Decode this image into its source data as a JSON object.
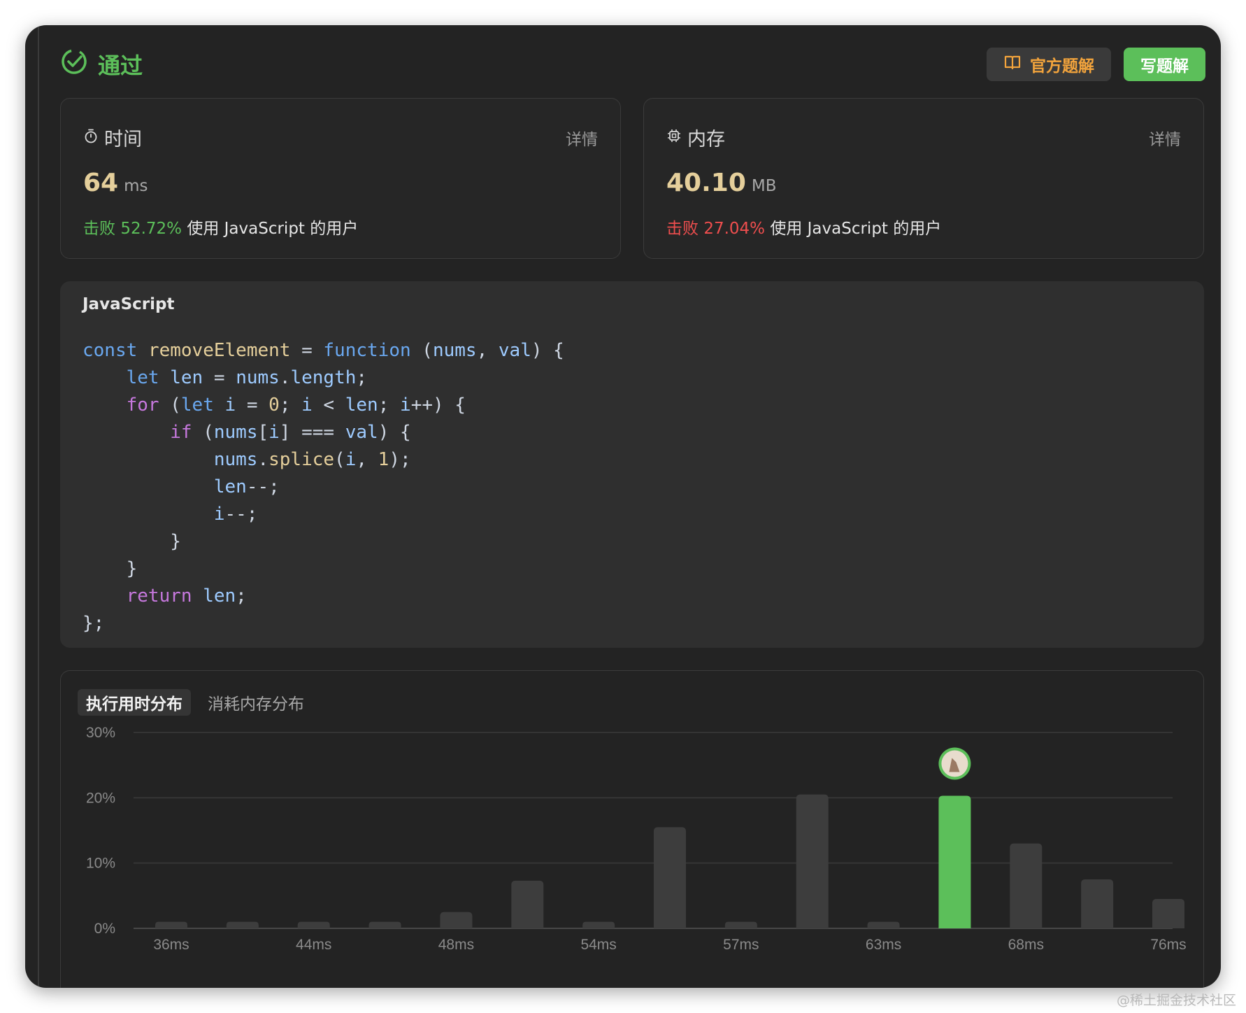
{
  "header": {
    "status": "通过",
    "official_solution_label": "官方题解",
    "write_solution_label": "写题解"
  },
  "colors": {
    "pass": "#5cbf5a",
    "fail": "#ef4e4e",
    "accent_orange": "#f3a43c"
  },
  "time_card": {
    "title": "时间",
    "detail": "详情",
    "value": "64",
    "unit": "ms",
    "beat_prefix": "击败",
    "beat_percent": "52.72%",
    "beat_suffix": "使用 JavaScript 的用户"
  },
  "memory_card": {
    "title": "内存",
    "detail": "详情",
    "value": "40.10",
    "unit": "MB",
    "beat_prefix": "击败",
    "beat_percent": "27.04%",
    "beat_suffix": "使用 JavaScript 的用户"
  },
  "code": {
    "language": "JavaScript",
    "lines": [
      "const removeElement = function (nums, val) {",
      "    let len = nums.length;",
      "    for (let i = 0; i < len; i++) {",
      "        if (nums[i] === val) {",
      "            nums.splice(i, 1);",
      "            len--;",
      "            i--;",
      "        }",
      "    }",
      "    return len;",
      "};"
    ]
  },
  "chart_tabs": [
    "执行用时分布",
    "消耗内存分布"
  ],
  "chart_data": {
    "type": "bar",
    "title": "",
    "xlabel": "",
    "ylabel": "",
    "ylim": [
      0,
      30
    ],
    "y_ticks": [
      "30%",
      "20%",
      "10%",
      "0%"
    ],
    "x_tick_labels": [
      "36ms",
      "44ms",
      "48ms",
      "54ms",
      "57ms",
      "63ms",
      "68ms",
      "76ms"
    ],
    "values": [
      1.0,
      1.0,
      1.0,
      1.0,
      2.5,
      7.3,
      1.0,
      15.5,
      1.0,
      20.5,
      1.0,
      20.3,
      13.0,
      7.5,
      4.5
    ],
    "highlight_index": 11,
    "highlight_color": "#5cbf5a",
    "bar_color": "#3d3d3d",
    "grid": true
  },
  "watermark": "@稀土掘金技术社区"
}
